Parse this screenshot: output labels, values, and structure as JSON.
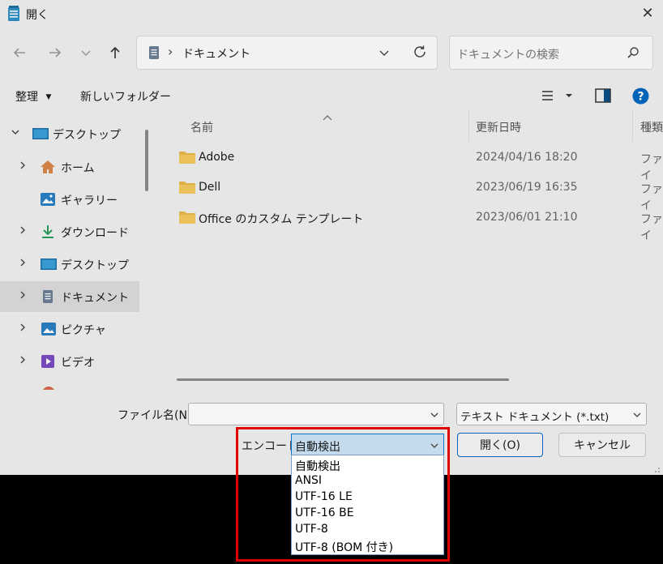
{
  "window": {
    "title": "開く",
    "close_glyph": "✕"
  },
  "address": {
    "path": "ドキュメント",
    "separator": "›"
  },
  "search": {
    "placeholder": "ドキュメントの検索"
  },
  "toolbar": {
    "organize": "整理",
    "new_folder": "新しいフォルダー"
  },
  "sidebar": {
    "items": [
      {
        "label": "デスクトップ",
        "icon": "desktop-icon",
        "expanded": true
      },
      {
        "label": "ホーム",
        "icon": "home-icon"
      },
      {
        "label": "ギャラリー",
        "icon": "gallery-icon"
      },
      {
        "label": "ダウンロード",
        "icon": "download-icon"
      },
      {
        "label": "デスクトップ",
        "icon": "desktop-icon"
      },
      {
        "label": "ドキュメント",
        "icon": "document-icon",
        "selected": true
      },
      {
        "label": "ピクチャ",
        "icon": "pictures-icon"
      },
      {
        "label": "ビデオ",
        "icon": "video-icon"
      }
    ]
  },
  "columns": {
    "name": "名前",
    "modified": "更新日時",
    "type": "種類"
  },
  "files": [
    {
      "name": "Adobe",
      "modified": "2024/04/16 18:20",
      "type": "ファイ"
    },
    {
      "name": "Dell",
      "modified": "2023/06/19 16:35",
      "type": "ファイ"
    },
    {
      "name": "Office のカスタム テンプレート",
      "modified": "2023/06/01 21:10",
      "type": "ファイ"
    }
  ],
  "footer": {
    "filename_label": "ファイル名(N):",
    "filename_value": "",
    "filetype_value": "テキスト ドキュメント (*.txt)",
    "encoding_label": "エンコード:",
    "encoding_value": "自動検出",
    "open_button": "開く(O)",
    "cancel_button": "キャンセル"
  },
  "encoding_options": [
    "自動検出",
    "ANSI",
    "UTF-16 LE",
    "UTF-16 BE",
    "UTF-8",
    "UTF-8 (BOM 付き)"
  ],
  "colors": {
    "accent": "#0067c0",
    "highlight": "#e00000",
    "folder": "#e8b94b"
  }
}
